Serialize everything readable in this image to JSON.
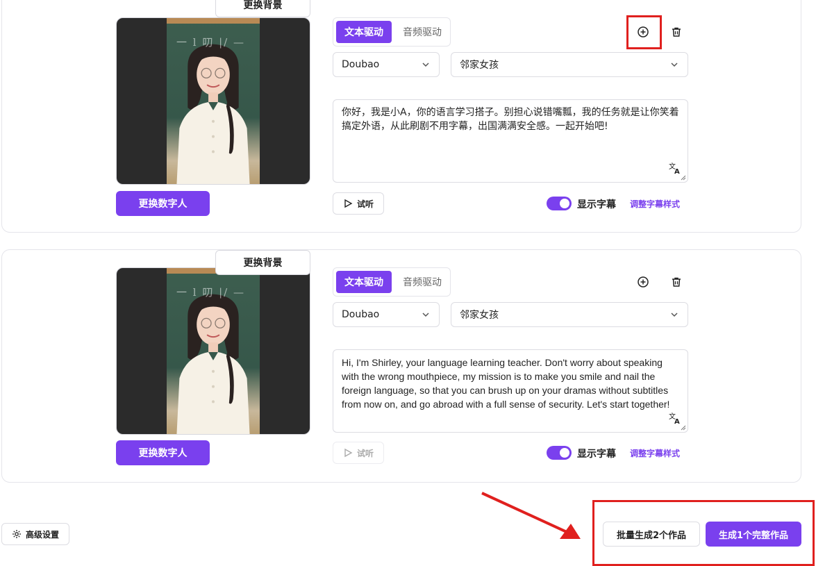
{
  "cards": [
    {
      "tabs": [
        {
          "label": "文本驱动"
        },
        {
          "label": "音频驱动"
        }
      ],
      "model": "Doubao",
      "voice": "邻家女孩",
      "script": "你好，我是小A，你的语言学习搭子。别担心说错嘴瓢，我的任务就是让你笑着搞定外语，从此刷剧不用字幕，出国满满安全感。一起开始吧!",
      "swap_label": "更换数字人",
      "bg_label": "更换背景",
      "listen_label": "试听",
      "subtitle_label": "显示字幕",
      "subtitle_style_label": "调整字幕样式",
      "chalk": "一 l 叨 |/ —"
    },
    {
      "tabs": [
        {
          "label": "文本驱动"
        },
        {
          "label": "音频驱动"
        }
      ],
      "model": "Doubao",
      "voice": "邻家女孩",
      "script": "Hi, I'm Shirley, your language learning teacher. Don't worry about speaking with the wrong mouthpiece, my mission is to make you smile and nail the foreign language, so that you can brush up on your dramas without subtitles from now on, and go abroad with a full sense of security. Let's start together!",
      "swap_label": "更换数字人",
      "bg_label": "更换背景",
      "listen_label": "试听",
      "subtitle_label": "显示字幕",
      "subtitle_style_label": "调整字幕样式",
      "chalk": "一 l 叨 |/ —"
    }
  ],
  "footer": {
    "advanced_label": "高级设置",
    "batch_label": "批量生成2个作品",
    "full_label": "生成1个完整作品"
  },
  "colors": {
    "accent": "#7a40ee",
    "annotation": "#e0201e"
  }
}
